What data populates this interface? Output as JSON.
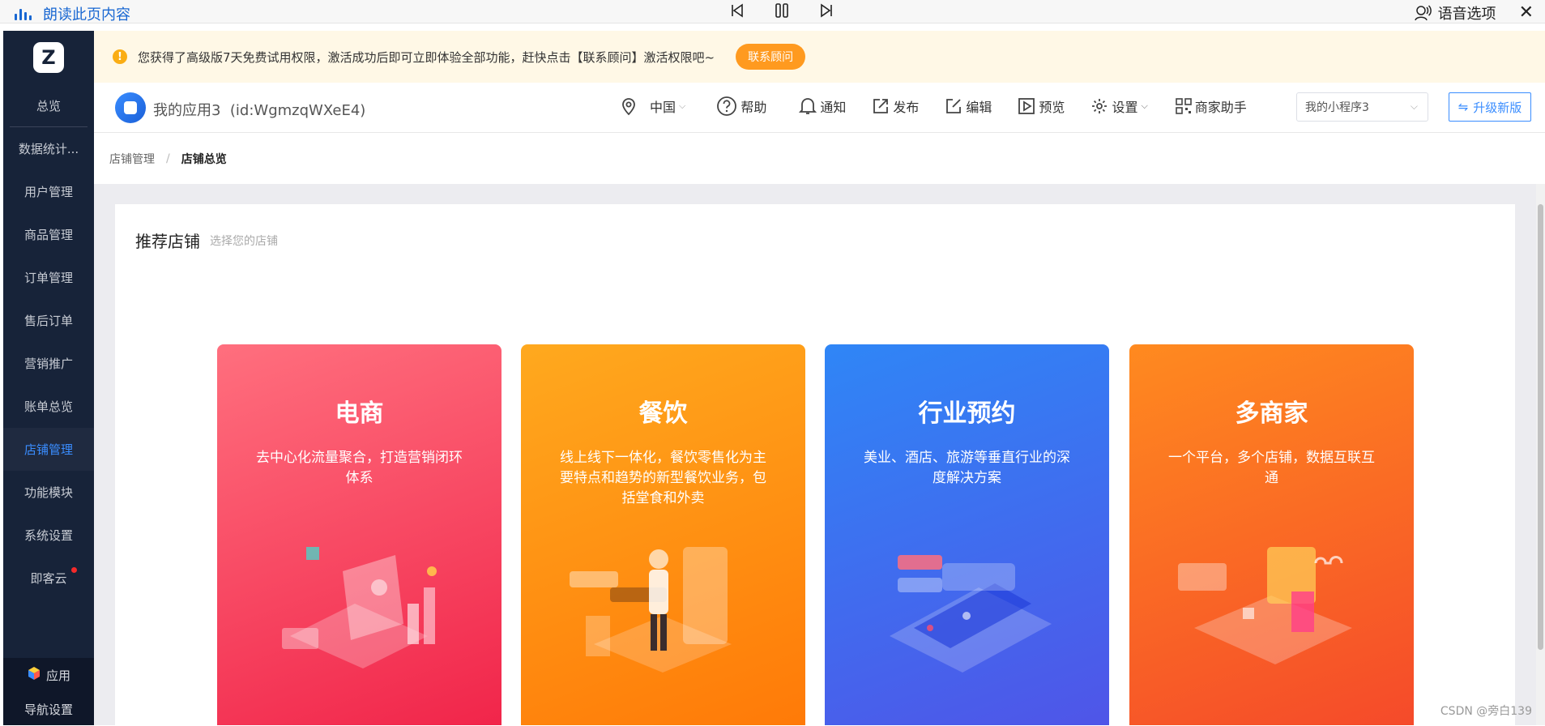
{
  "reader": {
    "read_label": "朗读此页内容",
    "voice_label": "语音选项"
  },
  "sidebar": {
    "items": [
      {
        "label": "总览"
      },
      {
        "label": "数据统计..."
      },
      {
        "label": "用户管理"
      },
      {
        "label": "商品管理"
      },
      {
        "label": "订单管理"
      },
      {
        "label": "售后订单"
      },
      {
        "label": "营销推广"
      },
      {
        "label": "账单总览"
      },
      {
        "label": "店铺管理"
      },
      {
        "label": "功能模块"
      },
      {
        "label": "系统设置"
      },
      {
        "label": "即客云"
      }
    ],
    "active": "店铺管理",
    "bottom": {
      "app_label": "应用",
      "nav_label": "导航设置"
    }
  },
  "notice": {
    "text": "您获得了高级版7天免费试用权限，激活成功后即可立即体验全部功能，赶快点击【联系顾问】激活权限吧~",
    "button": "联系顾问"
  },
  "header": {
    "app_name": "我的应用3",
    "app_id": "(id:WgmzqWXeE4)",
    "region": "中国",
    "help": "帮助",
    "notify": "通知",
    "publish": "发布",
    "edit": "编辑",
    "preview": "预览",
    "settings": "设置",
    "merchant": "商家助手",
    "mini_program": "我的小程序3",
    "upgrade": "升级新版"
  },
  "breadcrumb": [
    "店铺管理",
    "店铺总览"
  ],
  "panel": {
    "title": "推荐店铺",
    "subtitle": "选择您的店铺"
  },
  "cards": [
    {
      "title": "电商",
      "desc": "去中心化流量聚合，打造营销闭环体系",
      "color": "#f1254a"
    },
    {
      "title": "餐饮",
      "desc": "线上线下一体化，餐饮零售化为主要特点和趋势的新型餐饮业务，包括堂食和外卖",
      "color": "#ff7a08"
    },
    {
      "title": "行业预约",
      "desc": "美业、酒店、旅游等垂直行业的深度解决方案",
      "color": "#4f55e8"
    },
    {
      "title": "多商家",
      "desc": "一个平台，多个店铺，数据互联互通",
      "color": "#f54a2a"
    }
  ],
  "watermark": "CSDN @旁白139"
}
